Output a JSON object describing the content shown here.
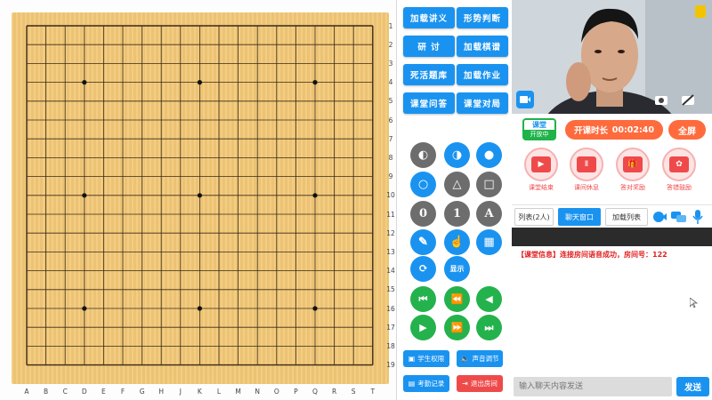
{
  "board": {
    "cols": [
      "A",
      "B",
      "C",
      "D",
      "E",
      "F",
      "G",
      "H",
      "J",
      "K",
      "L",
      "M",
      "N",
      "O",
      "P",
      "Q",
      "R",
      "S",
      "T"
    ],
    "rows": [
      "1",
      "2",
      "3",
      "4",
      "5",
      "6",
      "7",
      "8",
      "9",
      "10",
      "11",
      "12",
      "13",
      "14",
      "15",
      "16",
      "17",
      "18",
      "19"
    ],
    "star_points": [
      [
        "D",
        4
      ],
      [
        "K",
        4
      ],
      [
        "Q",
        4
      ],
      [
        "D",
        10
      ],
      [
        "K",
        10
      ],
      [
        "Q",
        10
      ],
      [
        "D",
        16
      ],
      [
        "K",
        16
      ],
      [
        "Q",
        16
      ]
    ],
    "colors": {
      "wood": "#f3c979",
      "line": "#3a2a14"
    }
  },
  "tools": {
    "top_buttons": [
      "加载讲义",
      "形势判断",
      "研 讨",
      "加载棋谱",
      "死活题库",
      "加载作业",
      "课堂问答",
      "课堂对局"
    ],
    "mode_buttons": [
      {
        "name": "alternate-stone-icon",
        "glyph": "◐"
      },
      {
        "name": "black-stone-icon",
        "glyph": "◑"
      },
      {
        "name": "black-dot-icon",
        "glyph": "●"
      },
      {
        "name": "circle-mark-icon",
        "glyph": "○"
      },
      {
        "name": "triangle-mark-icon",
        "glyph": "△"
      },
      {
        "name": "square-mark-icon",
        "glyph": "□"
      },
      {
        "name": "zero-mark-icon",
        "glyph": "0"
      },
      {
        "name": "one-mark-icon",
        "glyph": "1"
      },
      {
        "name": "letter-mark-icon",
        "glyph": "A"
      },
      {
        "name": "brush-icon",
        "glyph": "✎"
      },
      {
        "name": "hand-pointer-icon",
        "glyph": "☝"
      },
      {
        "name": "paint-roller-icon",
        "glyph": "▦"
      },
      {
        "name": "refresh-icon",
        "glyph": "⟳"
      },
      {
        "name": "display-icon",
        "glyph": "显示"
      }
    ],
    "nav_buttons": [
      {
        "name": "first-move-icon",
        "glyph": "⏮"
      },
      {
        "name": "rewind-icon",
        "glyph": "⏪"
      },
      {
        "name": "previous-move-icon",
        "glyph": "◀"
      },
      {
        "name": "next-move-icon",
        "glyph": "▶"
      },
      {
        "name": "fast-forward-icon",
        "glyph": "⏩"
      },
      {
        "name": "last-move-icon",
        "glyph": "⏭"
      }
    ],
    "bottom_buttons": [
      {
        "label": "学生权限",
        "icon": "▣"
      },
      {
        "label": "声音调节",
        "icon": "🔈"
      },
      {
        "label": "考勤记录",
        "icon": "▤"
      },
      {
        "label": "退出房间",
        "icon": "⇥"
      }
    ]
  },
  "class_bar": {
    "badge_top": "课堂",
    "badge_bottom": "开放中",
    "timer_label": "开课时长",
    "timer_value": "00:02:40",
    "fullscreen_label": "全屏",
    "actions": [
      {
        "label": "课堂结束",
        "glyph": "▶"
      },
      {
        "label": "课间休息",
        "glyph": "Ⅱ"
      },
      {
        "label": "答对奖励",
        "glyph": "🎁"
      },
      {
        "label": "答错鼓励",
        "glyph": "✿"
      }
    ]
  },
  "chat": {
    "tabs": [
      "列表(2人)",
      "聊天窗口",
      "加载列表"
    ],
    "message_tag": "【课堂信息】",
    "message_text": "连接房间语音成功，房间号：122",
    "input_placeholder": "输入聊天内容发送",
    "send_label": "发送"
  }
}
